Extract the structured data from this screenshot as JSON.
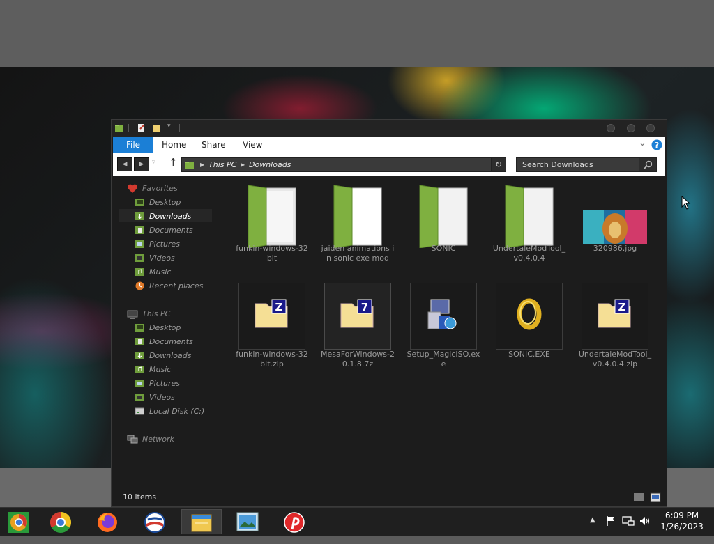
{
  "ribbon": {
    "file": "File",
    "tabs": [
      "Home",
      "Share",
      "View"
    ]
  },
  "address": {
    "crumbs": [
      "This PC",
      "Downloads"
    ]
  },
  "search": {
    "placeholder": "Search Downloads"
  },
  "nav": {
    "favorites": {
      "label": "Favorites",
      "items": [
        "Desktop",
        "Downloads",
        "Documents",
        "Pictures",
        "Videos",
        "Music",
        "Recent places"
      ]
    },
    "this_pc": {
      "label": "This PC",
      "items": [
        "Desktop",
        "Documents",
        "Downloads",
        "Music",
        "Pictures",
        "Videos",
        "Local Disk (C:)"
      ]
    },
    "network": {
      "label": "Network"
    },
    "selected": "Downloads"
  },
  "files": [
    {
      "name": "funkin-windows-32bit",
      "type": "folder"
    },
    {
      "name": "jaiden animations in sonic exe mod",
      "type": "folder"
    },
    {
      "name": "SONIC",
      "type": "folder"
    },
    {
      "name": "UndertaleModTool_v0.4.0.4",
      "type": "folder"
    },
    {
      "name": "320986.jpg",
      "type": "image"
    },
    {
      "name": "funkin-windows-32bit.zip",
      "type": "zip"
    },
    {
      "name": "MesaForWindows-20.1.8.7z",
      "type": "7z"
    },
    {
      "name": "Setup_MagicISO.exe",
      "type": "installer"
    },
    {
      "name": "SONIC.EXE",
      "type": "exe"
    },
    {
      "name": "UndertaleModTool_v0.4.0.4.zip",
      "type": "zip"
    }
  ],
  "status": {
    "items": "10 items"
  },
  "clock": {
    "time": "6:09 PM",
    "date": "1/26/2023"
  },
  "colors": {
    "accent": "#1b7fd6",
    "folder": "#7fb040",
    "window": "#1c1c1c"
  },
  "taskbar": {
    "apps": [
      "Chrome Canary",
      "Google Chrome",
      "Firefox",
      "Opera",
      "File Explorer",
      "Photos",
      "Pinterest"
    ]
  }
}
